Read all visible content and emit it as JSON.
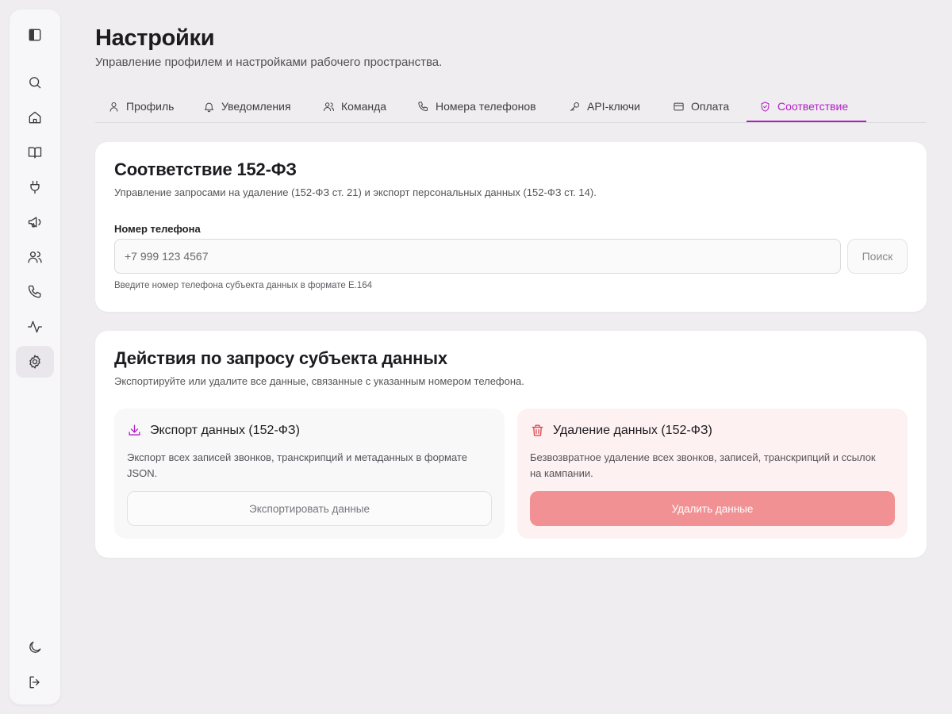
{
  "sidebar": {
    "items": [
      {
        "icon": "panel-toggle-icon"
      },
      {
        "icon": "search-icon"
      },
      {
        "icon": "home-icon"
      },
      {
        "icon": "book-icon"
      },
      {
        "icon": "plug-icon"
      },
      {
        "icon": "megaphone-icon"
      },
      {
        "icon": "users-icon"
      },
      {
        "icon": "phone-icon"
      },
      {
        "icon": "activity-icon"
      },
      {
        "icon": "gear-icon",
        "active": true
      },
      {
        "icon": "moon-icon"
      },
      {
        "icon": "logout-icon"
      }
    ]
  },
  "header": {
    "title": "Настройки",
    "subtitle": "Управление профилем и настройками рабочего пространства."
  },
  "tabs": [
    {
      "label": "Профиль",
      "icon": "user-icon"
    },
    {
      "label": "Уведомления",
      "icon": "bell-icon"
    },
    {
      "label": "Команда",
      "icon": "users-icon"
    },
    {
      "label": "Номера телефонов",
      "icon": "phone-icon"
    },
    {
      "label": "API-ключи",
      "icon": "key-icon"
    },
    {
      "label": "Оплата",
      "icon": "card-icon"
    },
    {
      "label": "Соответствие",
      "icon": "shield-icon",
      "active": true
    }
  ],
  "compliance": {
    "title": "Соответствие 152-ФЗ",
    "description": "Управление запросами на удаление (152-ФЗ ст. 21) и экспорт персональных данных (152-ФЗ ст. 14).",
    "phone_label": "Номер телефона",
    "phone_placeholder": "+7 999 123 4567",
    "phone_value": "",
    "search_label": "Поиск",
    "hint": "Введите номер телефона субъекта данных в формате E.164"
  },
  "actions": {
    "title": "Действия по запросу субъекта данных",
    "description": "Экспортируйте или удалите все данные, связанные с указанным номером телефона.",
    "export": {
      "title": "Экспорт данных (152-ФЗ)",
      "description": "Экспорт всех записей звонков, транскрипций и метаданных в формате JSON.",
      "button": "Экспортировать данные"
    },
    "delete": {
      "title": "Удаление данных (152-ФЗ)",
      "description": "Безвозвратное удаление всех звонков, записей, транскрипций и ссылок на кампании.",
      "button": "Удалить данные"
    }
  },
  "colors": {
    "accent": "#b11fc3",
    "danger": "#e5484d",
    "danger_button": "#f29193",
    "background": "#efedf0"
  }
}
